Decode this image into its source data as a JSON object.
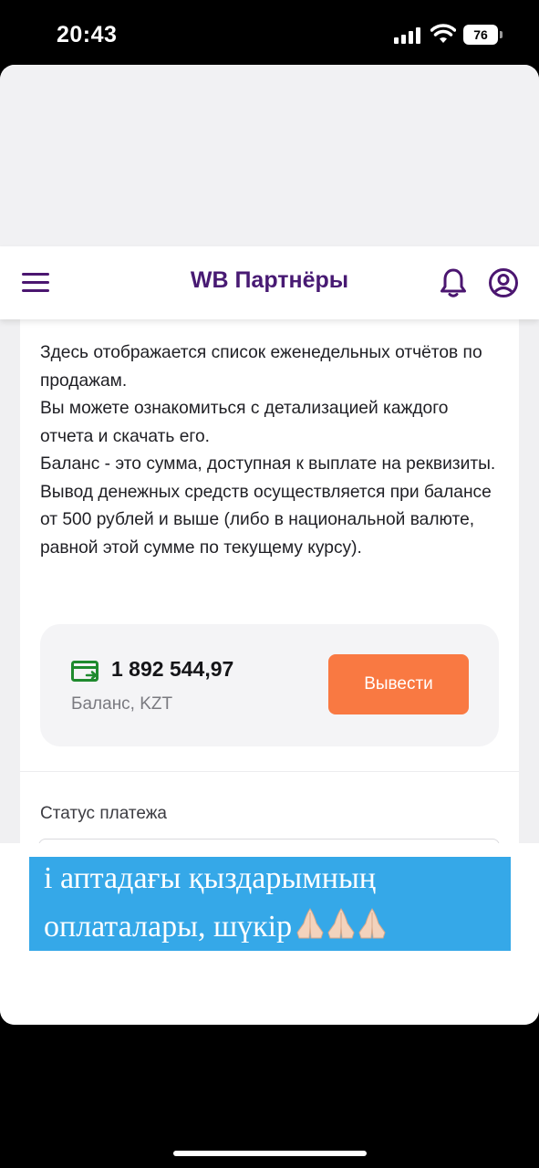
{
  "status_bar": {
    "time": "20:43",
    "battery": "76"
  },
  "header": {
    "title": "WB Партнёры",
    "icons": [
      "menu-icon",
      "bell-icon",
      "profile-icon"
    ]
  },
  "description": [
    "Здесь отображается список еженедельных отчётов по продажам.",
    "Вы можете ознакомиться с детализацией каждого отчета и скачать его.",
    "Баланс - это сумма, доступная к выплате на реквизиты. Вывод денежных средств осуществляется при балансе от 500 рублей и выше (либо в национальной валюте, равной этой сумме по текущему курсу)."
  ],
  "balance": {
    "amount": "1 892 544,97",
    "label": "Баланс, KZT",
    "withdraw_label": "Вывести"
  },
  "payment_status": {
    "label": "Статус платежа"
  },
  "caption": {
    "line1": "і аптадағы қыздарымның",
    "line2": "оплаталары, шүкір",
    "emoji": "🙏🏻🙏🏻🙏🏻"
  },
  "colors": {
    "brand": "#481a73",
    "accent_button": "#f97942",
    "wallet_icon": "#1f8a2e",
    "caption_bg": "#35a8e8"
  }
}
